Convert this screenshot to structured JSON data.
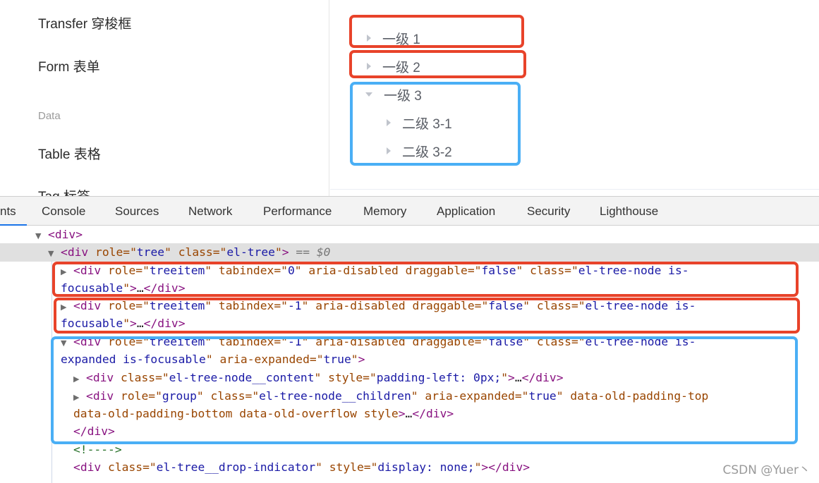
{
  "sidebar": {
    "items": [
      {
        "label": "Transfer 穿梭框"
      },
      {
        "label": "Form 表单"
      },
      {
        "label": "Table 表格"
      },
      {
        "label": "Tag 标签"
      }
    ],
    "group_label": "Data"
  },
  "tree": {
    "nodes": [
      {
        "label": "一级 1",
        "expanded": false
      },
      {
        "label": "一级 2",
        "expanded": false
      },
      {
        "label": "一级 3",
        "expanded": true
      },
      {
        "label": "二级 3-1",
        "expanded": false
      },
      {
        "label": "二级 3-2",
        "expanded": false
      }
    ]
  },
  "devtools": {
    "tabs": [
      {
        "label": "nts",
        "active": true
      },
      {
        "label": "Console"
      },
      {
        "label": "Sources"
      },
      {
        "label": "Network"
      },
      {
        "label": "Performance"
      },
      {
        "label": "Memory"
      },
      {
        "label": "Application"
      },
      {
        "label": "Security"
      },
      {
        "label": "Lighthouse"
      }
    ],
    "dom": {
      "tag_div": "div",
      "role_attr": "role",
      "class_attr": "class",
      "tabindex_attr": "tabindex",
      "aria_disabled": "aria-disabled",
      "draggable_attr": "draggable",
      "aria_expanded_attr": "aria-expanded",
      "style_attr": "style",
      "role_tree": "tree",
      "class_el_tree": "el-tree",
      "selected_marker": "== $0",
      "role_treeitem": "treeitem",
      "tabindex_0": "0",
      "tabindex_neg1": "-1",
      "false_val": "false",
      "true_val": "true",
      "class_node_prefix": "el-tree-node is-",
      "focusable_suffix": "focusable",
      "expanded_suffix": "expanded is-focusable",
      "ellipsis": "…",
      "class_content": "el-tree-node__content",
      "style_padding": "padding-left: 0px;",
      "role_group": "group",
      "class_children": "el-tree-node__children",
      "old_padding_top": "data-old-padding-top",
      "old_padding_bottom": "data-old-padding-bottom",
      "old_overflow": "data-old-overflow",
      "style_bare": "style",
      "comment": "<!---->",
      "class_drop": "el-tree__drop-indicator",
      "style_none": "display: none;"
    }
  },
  "watermark": "CSDN @Yuer丶"
}
